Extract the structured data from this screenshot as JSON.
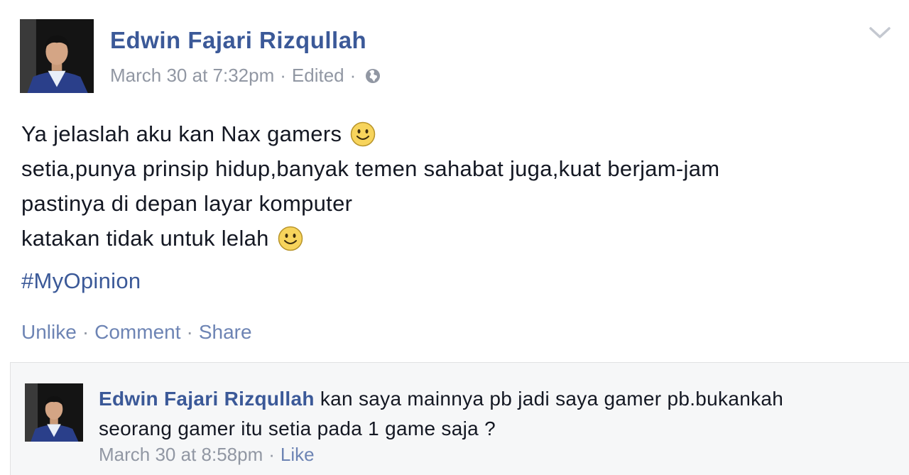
{
  "post": {
    "author": "Edwin Fajari Rizqullah",
    "timestamp": "March 30 at 7:32pm",
    "edited": "Edited",
    "separator": "·",
    "privacy_icon": "globe-icon",
    "menu_icon": "chevron-down-icon",
    "lines": [
      "Ya jelaslah aku kan Nax gamers",
      "setia,punya prinsip hidup,banyak temen sahabat juga,kuat berjam-jam",
      "pastinya di depan layar komputer",
      "katakan tidak untuk lelah"
    ],
    "emoticon_icon": "smile-icon",
    "hashtag": "#MyOpinion",
    "actions": {
      "unlike": "Unlike",
      "comment": "Comment",
      "share": "Share"
    }
  },
  "comment": {
    "author": "Edwin Fajari Rizqullah",
    "text_line1": "kan saya mainnya pb jadi saya gamer pb.bukankah",
    "text_line2": "seorang gamer itu setia pada 1 game saja ?",
    "timestamp": "March 30 at 8:58pm",
    "like": "Like"
  },
  "colors": {
    "link": "#3b5998",
    "action_link": "#6d84b4",
    "meta": "#9197a3",
    "text": "#141823",
    "comment_bg": "#f6f7f8"
  }
}
